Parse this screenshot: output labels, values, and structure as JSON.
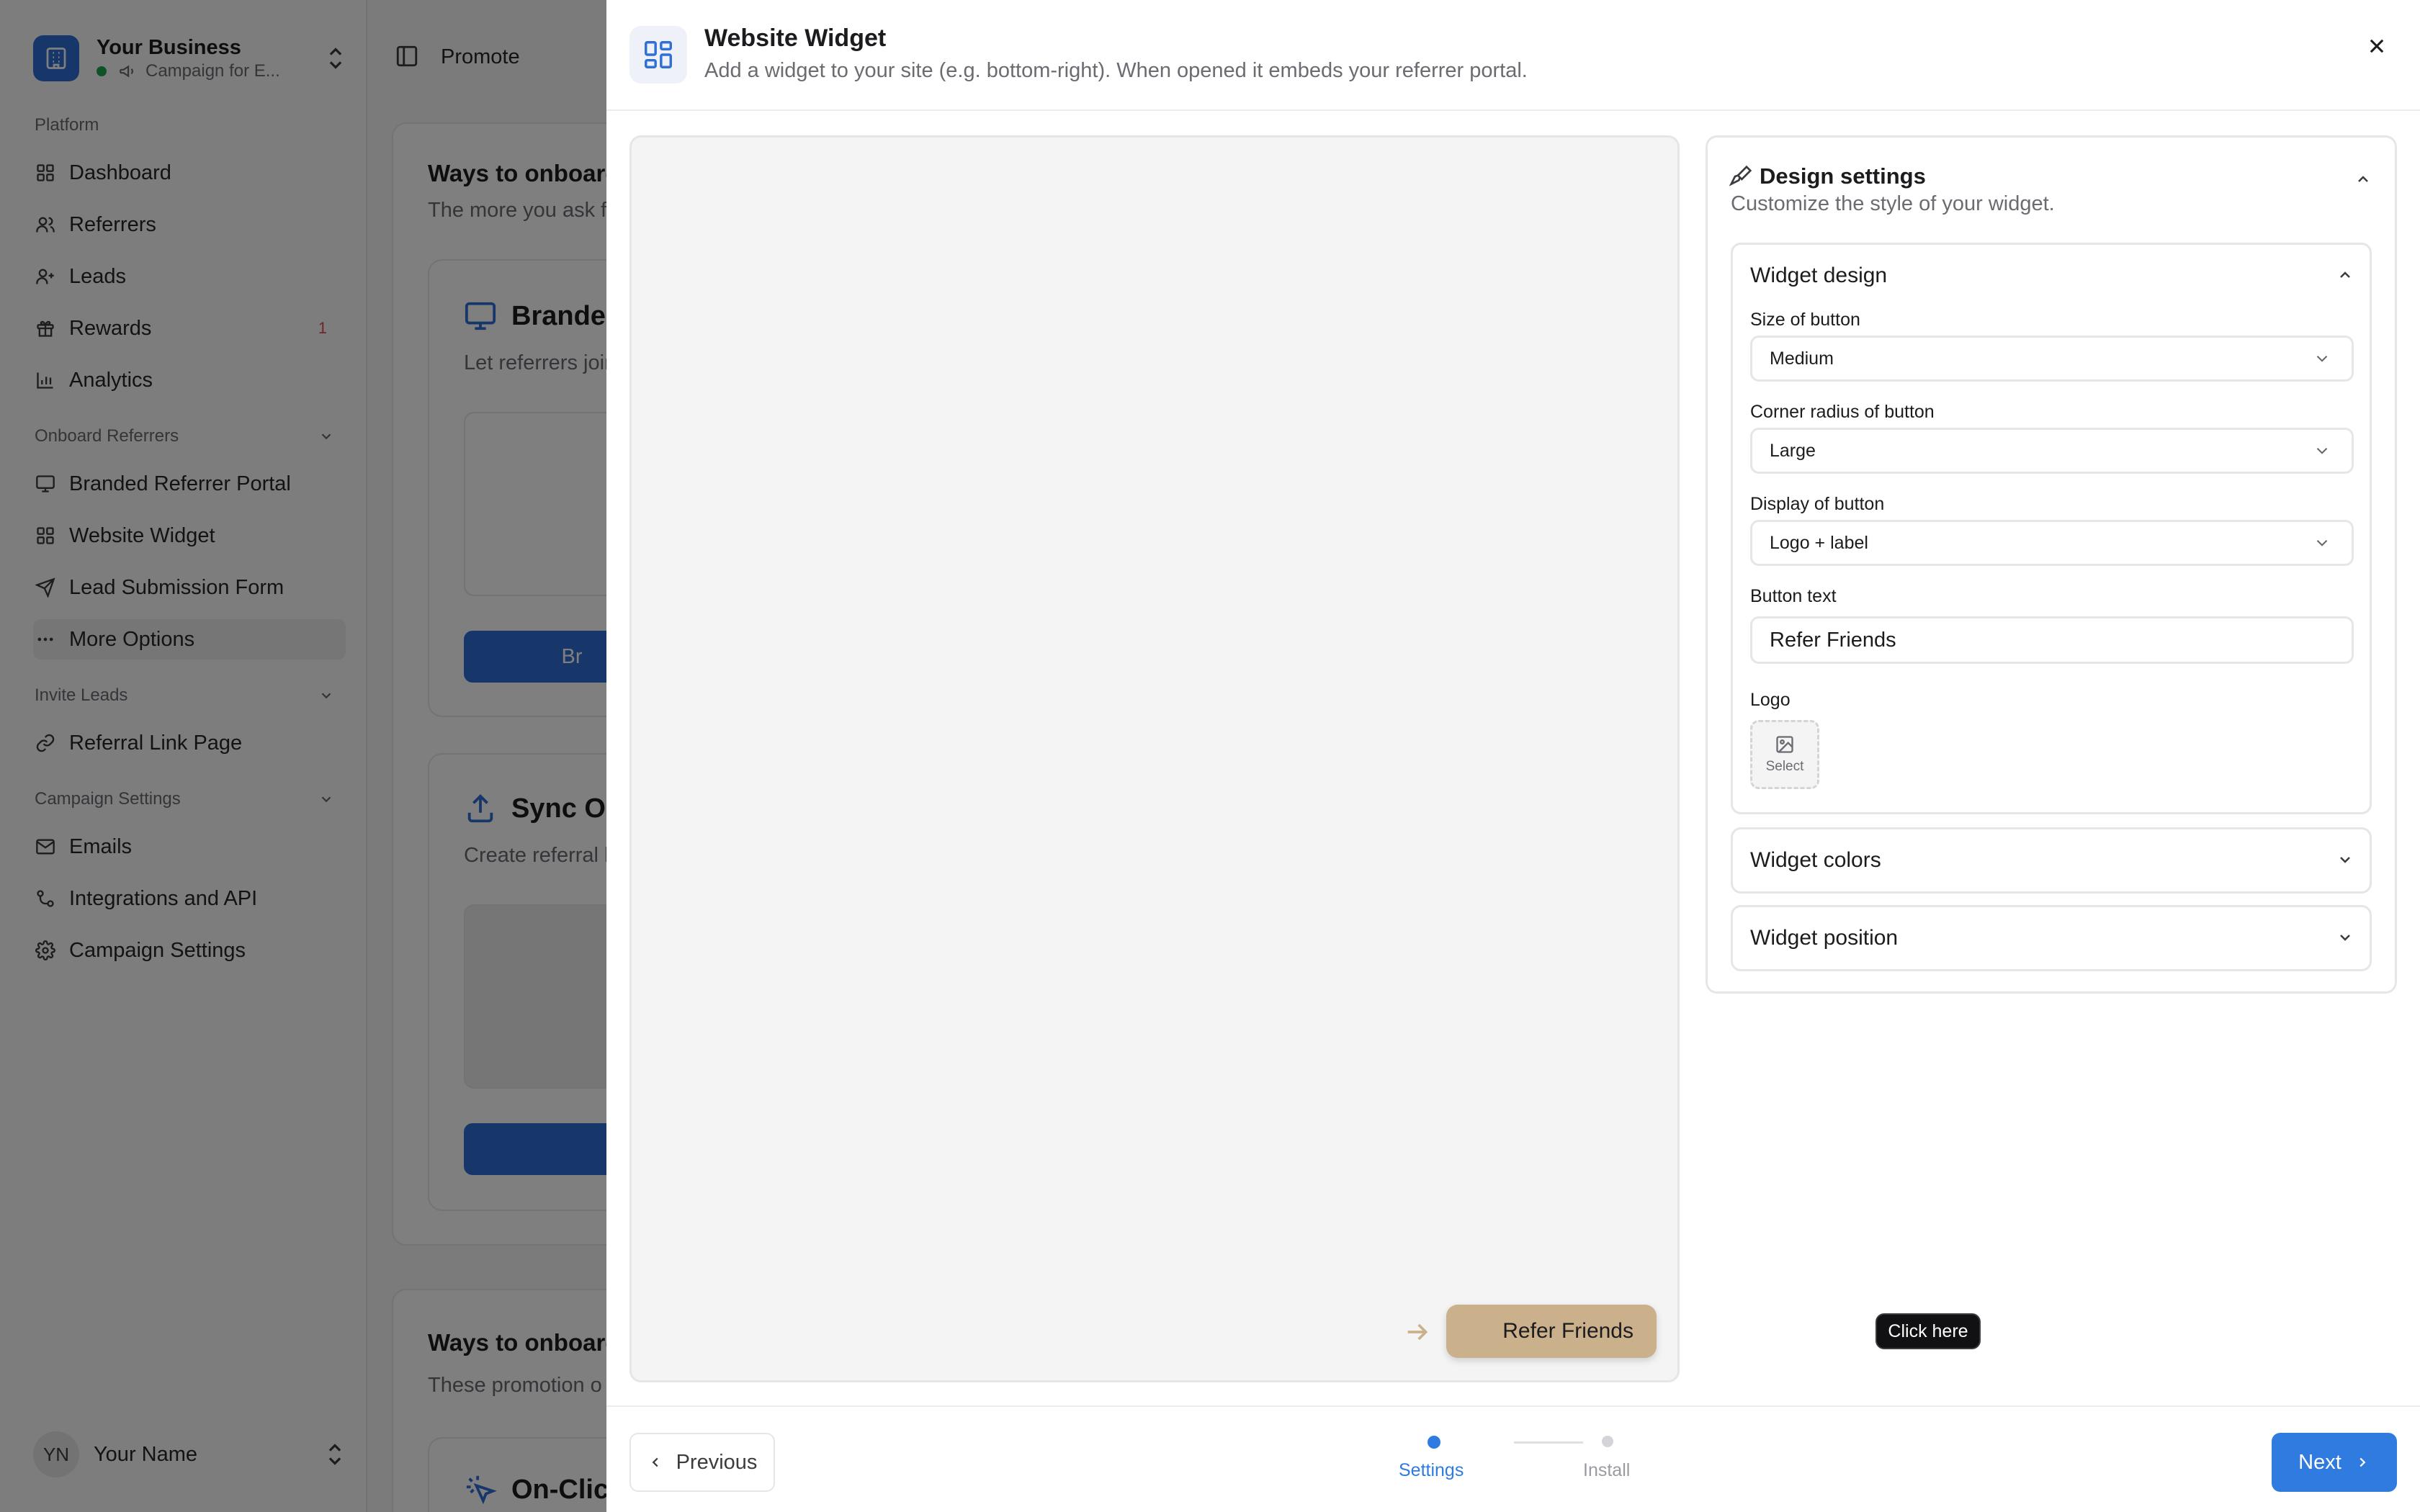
{
  "sidebar": {
    "business_name": "Your Business",
    "campaign": "Campaign for E...",
    "sections": {
      "platform": "Platform",
      "onboard": "Onboard Referrers",
      "invite": "Invite Leads",
      "campaign_settings": "Campaign Settings"
    },
    "platform_items": [
      {
        "label": "Dashboard",
        "icon": "grid-icon"
      },
      {
        "label": "Referrers",
        "icon": "users-icon"
      },
      {
        "label": "Leads",
        "icon": "user-plus-icon"
      },
      {
        "label": "Rewards",
        "icon": "gift-icon",
        "badge": "1"
      },
      {
        "label": "Analytics",
        "icon": "bar-chart-icon"
      }
    ],
    "onboard_items": [
      {
        "label": "Branded Referrer Portal",
        "icon": "monitor-icon"
      },
      {
        "label": "Website Widget",
        "icon": "grid-icon"
      },
      {
        "label": "Lead Submission Form",
        "icon": "send-icon"
      },
      {
        "label": "More Options",
        "icon": "more-icon"
      }
    ],
    "invite_items": [
      {
        "label": "Referral Link Page",
        "icon": "link-icon"
      }
    ],
    "settings_items": [
      {
        "label": "Emails",
        "icon": "mail-icon"
      },
      {
        "label": "Integrations and API",
        "icon": "integrations-icon"
      },
      {
        "label": "Campaign Settings",
        "icon": "gear-icon"
      }
    ],
    "user_initials": "YN",
    "user_name": "Your Name"
  },
  "topbar": {
    "title": "Promote"
  },
  "background": {
    "section1_title": "Ways to onboard",
    "section1_sub": "The more you ask fo",
    "card1_title": "Brandec",
    "card1_text": "Let referrers join",
    "card1_btn": "Br",
    "card2_title": "Sync On",
    "card2_text": "Create referral l",
    "section2_title": "Ways to onboard",
    "section2_sub": "These promotion o",
    "card3_title": "On-Clic"
  },
  "modal": {
    "title": "Website Widget",
    "subtitle": "Add a widget to your site (e.g. bottom-right). When opened it embeds your referrer portal.",
    "preview": {
      "tooltip": "Click here",
      "button_text": "Refer Friends"
    },
    "design": {
      "title": "Design settings",
      "subtitle": "Customize the style of your widget.",
      "widget_design": {
        "title": "Widget design",
        "size_label": "Size of button",
        "size_value": "Medium",
        "radius_label": "Corner radius of button",
        "radius_value": "Large",
        "display_label": "Display of button",
        "display_value": "Logo + label",
        "text_label": "Button text",
        "text_value": "Refer Friends",
        "logo_label": "Logo",
        "logo_select": "Select"
      },
      "widget_colors": "Widget colors",
      "widget_position": "Widget position"
    },
    "footer": {
      "previous": "Previous",
      "next": "Next",
      "steps": [
        "Settings",
        "Install"
      ],
      "current_step": 0
    }
  },
  "colors": {
    "accent": "#2f7be0",
    "widget_button": "#cbb08c",
    "badge": "#e0484f",
    "status_online": "#22a34a"
  }
}
